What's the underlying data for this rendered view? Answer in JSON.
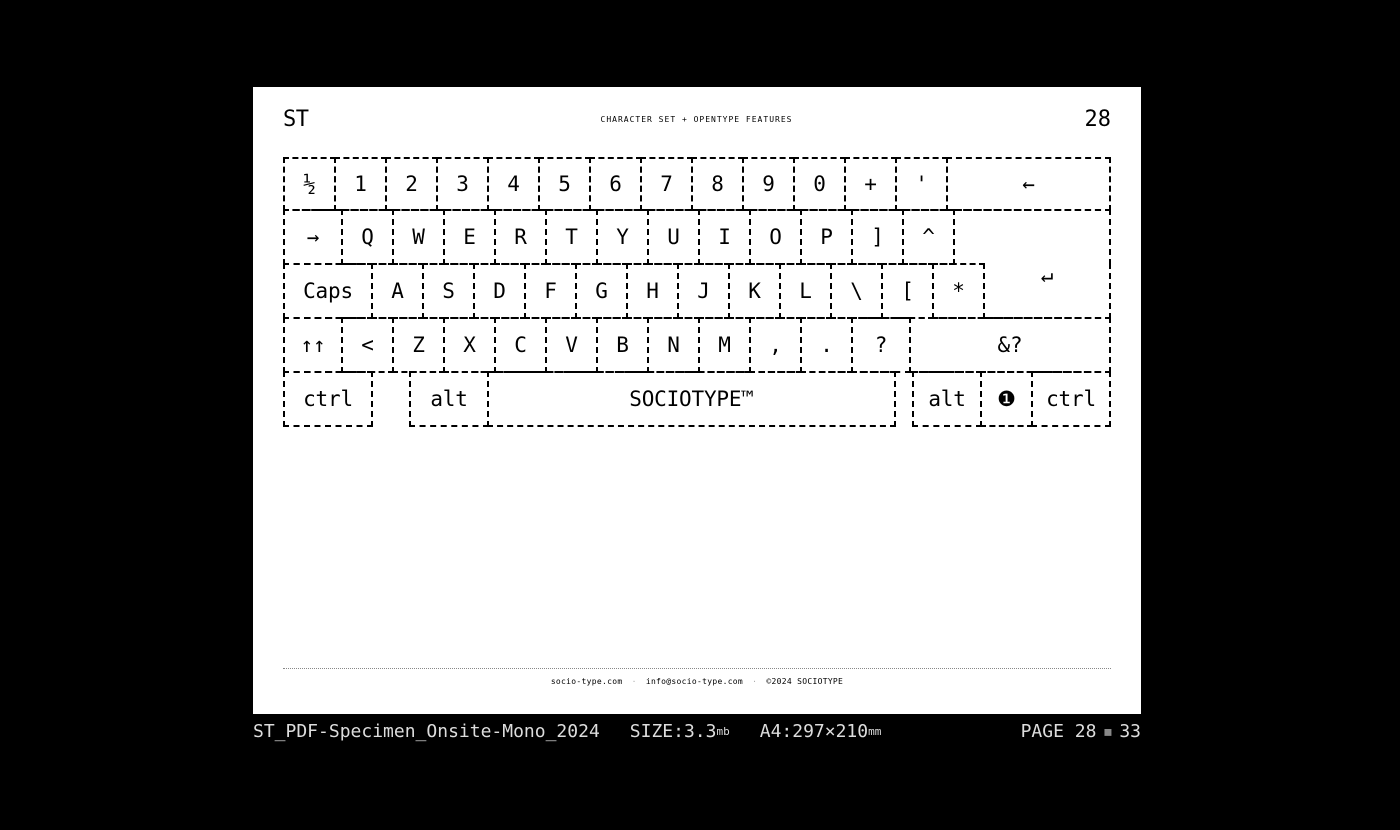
{
  "header": {
    "logo": "ST",
    "title": "CHARACTER SET + OPENTYPE FEATURES",
    "page": "28"
  },
  "keys": {
    "r1": [
      "½",
      "1",
      "2",
      "3",
      "4",
      "5",
      "6",
      "7",
      "8",
      "9",
      "0",
      "+",
      "'",
      "←"
    ],
    "r2": [
      "→",
      "Q",
      "W",
      "E",
      "R",
      "T",
      "Y",
      "U",
      "I",
      "O",
      "P",
      "]",
      "^"
    ],
    "r3": [
      "Caps",
      "A",
      "S",
      "D",
      "F",
      "G",
      "H",
      "J",
      "K",
      "L",
      "\\",
      "[",
      "*"
    ],
    "enter": "↵",
    "r4": [
      "↑↑",
      "<",
      "Z",
      "X",
      "C",
      "V",
      "B",
      "N",
      "M",
      ",",
      ".",
      "?",
      "&?"
    ],
    "r5": {
      "ctrl1": "ctrl",
      "blank": "",
      "alt1": "alt",
      "space": "SOCIOTYPE™",
      "alt2": "alt",
      "menu": "❶",
      "ctrl2": "ctrl"
    }
  },
  "footer": {
    "url": "socio-type.com",
    "email": "info@socio-type.com",
    "copy": "©2024 SOCIOTYPE"
  },
  "statusbar": {
    "file": "ST_PDF-Specimen_Onsite-Mono_2024",
    "size_label": "SIZE:",
    "size_val": "3.3",
    "size_unit": "mb",
    "paper_label": "A4:",
    "paper_val": "297×210",
    "paper_unit": "mm",
    "page_label": "PAGE ",
    "page_cur": "28",
    "page_total": "33"
  }
}
